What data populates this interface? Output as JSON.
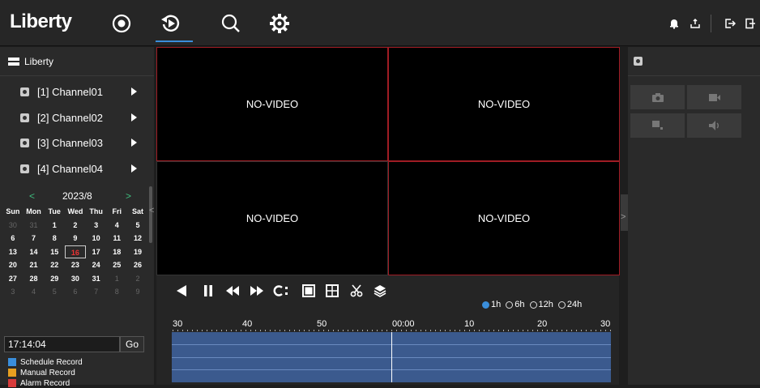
{
  "app": {
    "logo": "Liberty"
  },
  "tree": {
    "root_label": "Liberty",
    "channels": [
      {
        "label": "[1] Channel01"
      },
      {
        "label": "[2] Channel02"
      },
      {
        "label": "[3] Channel03"
      },
      {
        "label": "[4] Channel04"
      }
    ]
  },
  "calendar": {
    "prev": "<",
    "next": ">",
    "title": "2023/8",
    "weekdays": [
      "Sun",
      "Mon",
      "Tue",
      "Wed",
      "Thu",
      "Fri",
      "Sat"
    ],
    "weeks": [
      [
        "30",
        "31",
        "1",
        "2",
        "3",
        "4",
        "5"
      ],
      [
        "6",
        "7",
        "8",
        "9",
        "10",
        "11",
        "12"
      ],
      [
        "13",
        "14",
        "15",
        "16",
        "17",
        "18",
        "19"
      ],
      [
        "20",
        "21",
        "22",
        "23",
        "24",
        "25",
        "26"
      ],
      [
        "27",
        "28",
        "29",
        "30",
        "31",
        "1",
        "2"
      ],
      [
        "3",
        "4",
        "5",
        "6",
        "7",
        "8",
        "9"
      ]
    ],
    "selected_day": "16"
  },
  "time_search": {
    "value": "17:14:04",
    "go_label": "Go"
  },
  "legend": [
    {
      "label": "Schedule Record",
      "color": "#3a8edb"
    },
    {
      "label": "Manual Record",
      "color": "#e8a020"
    },
    {
      "label": "Alarm Record",
      "color": "#d83b3b"
    }
  ],
  "video": {
    "tiles": [
      {
        "label": "NO-VIDEO"
      },
      {
        "label": "NO-VIDEO"
      },
      {
        "label": "NO-VIDEO"
      },
      {
        "label": "NO-VIDEO"
      }
    ]
  },
  "collapse": {
    "left": "<",
    "right": ">"
  },
  "time_range": {
    "options": [
      "1h",
      "6h",
      "12h",
      "24h"
    ],
    "selected": "1h"
  },
  "ruler": {
    "labels": [
      "30",
      "40",
      "50",
      "00:00",
      "10",
      "20",
      "30"
    ]
  },
  "colors": {
    "accent": "#3a8edb",
    "selected_tile_border": "#a01c24",
    "timeline_fill": "#3b5a8e"
  },
  "icons": {
    "top_nav": [
      "live-view-icon",
      "playback-icon",
      "search-icon",
      "settings-icon"
    ],
    "top_right": [
      "alarm-bell-icon",
      "user-icon",
      "logout-icon",
      "exit-icon"
    ],
    "controls": [
      "reverse-play-icon",
      "pause-icon",
      "rewind-icon",
      "fast-forward-icon",
      "sync-icon",
      "single-view-icon",
      "quad-view-icon",
      "clip-icon",
      "layers-icon"
    ],
    "right_panel": [
      "snapshot-icon",
      "record-icon",
      "ptz-icon",
      "audio-icon"
    ]
  }
}
